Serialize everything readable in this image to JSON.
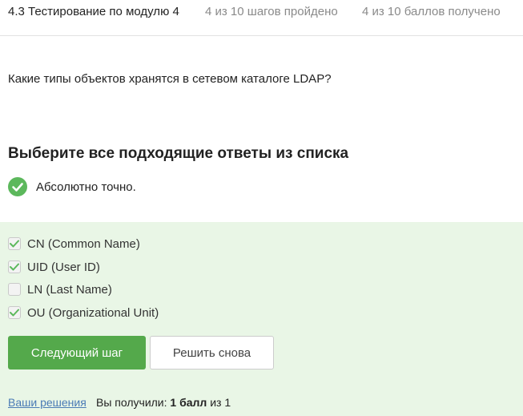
{
  "header": {
    "title": "4.3 Тестирование по модулю 4",
    "steps": "4 из 10 шагов пройдено",
    "score": "4 из 10 баллов  получено"
  },
  "question": {
    "text": "Какие типы объектов хранятся в сетевом каталоге LDAP?",
    "instruction": "Выберите все подходящие ответы из списка"
  },
  "verdict": {
    "text": "Абсолютно точно.",
    "color": "#5cb85c"
  },
  "options": [
    {
      "label": "CN (Common Name)",
      "checked": true
    },
    {
      "label": "UID (User ID)",
      "checked": true
    },
    {
      "label": "LN (Last Name)",
      "checked": false
    },
    {
      "label": "OU (Organizational Unit)",
      "checked": true
    }
  ],
  "actions": {
    "next_label": "Следующий шаг",
    "retry_label": "Решить снова"
  },
  "footer": {
    "solutions_link": "Ваши решения",
    "result_prefix": "Вы получили: ",
    "result_value": "1 балл",
    "result_suffix": " из 1"
  },
  "colors": {
    "accent_green": "#54a94b",
    "panel_bg": "#e9f6e6",
    "check_mark": "#5cb85c",
    "link": "#4a7bb5"
  }
}
